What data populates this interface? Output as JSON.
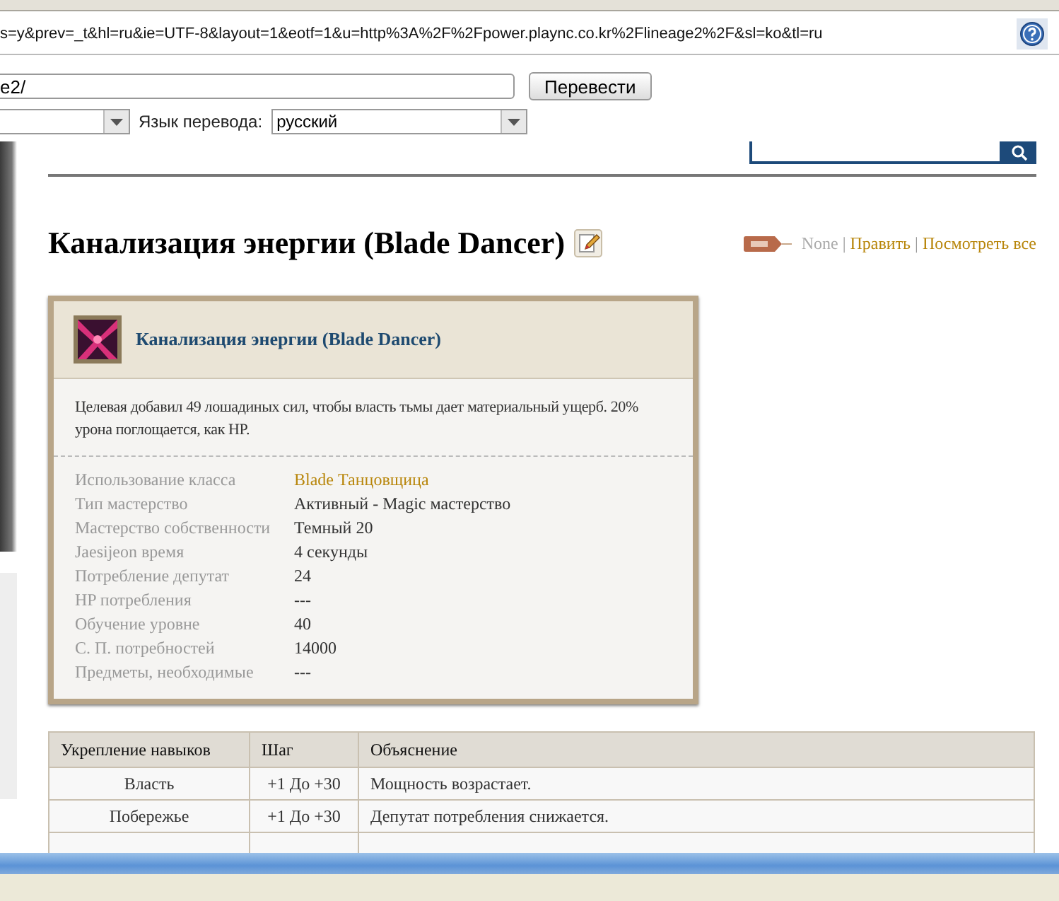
{
  "address_bar": {
    "url": "s=y&prev=_t&hl=ru&ie=UTF-8&layout=1&eotf=1&u=http%3A%2F%2Fpower.plaync.co.kr%2Flineage2%2F&sl=ko&tl=ru"
  },
  "translate_bar": {
    "url_value": "e2/",
    "translate_button": "Перевести",
    "target_label": "Язык перевода:",
    "target_value": "русский"
  },
  "page": {
    "title": "Канализация энергии (Blade Dancer)",
    "meta": {
      "author": "None",
      "separators": [
        "|",
        "|"
      ],
      "edit_link": "Править",
      "view_all_link": "Посмотреть все"
    },
    "skill_card": {
      "name": "Канализация энергии (Blade Dancer)",
      "description": "Целевая добавил 49 лошадиных сил, чтобы власть тьмы дает материальный ущерб. 20% урона поглощается, как HP.",
      "properties": [
        {
          "label": "Использование класса",
          "value": "Blade Танцовщица",
          "kind": "link"
        },
        {
          "label": "Тип мастерство",
          "value": "Активный - Magic мастерство",
          "kind": "text"
        },
        {
          "label": "Мастерство собственности",
          "value": "Темный 20",
          "kind": "text"
        },
        {
          "label": "Jaesijeon время",
          "value": "4 секунды",
          "kind": "text"
        },
        {
          "label": "Потребление депутат",
          "value": "24",
          "kind": "text"
        },
        {
          "label": "HP потребления",
          "value": "---",
          "kind": "text"
        },
        {
          "label": "Обучение уровне",
          "value": "40",
          "kind": "text"
        },
        {
          "label": "С. П. потребностей",
          "value": "14000",
          "kind": "text"
        },
        {
          "label": "Предметы, необходимые",
          "value": "---",
          "kind": "text"
        }
      ]
    },
    "enhance_table": {
      "columns": [
        "Укрепление навыков",
        "Шаг",
        "Объяснение"
      ],
      "rows": [
        [
          "Власть",
          "+1 До +30",
          "Мощность возрастает."
        ],
        [
          "Побережье",
          "+1 До +30",
          "Депутат потребления снижается."
        ]
      ]
    }
  }
}
